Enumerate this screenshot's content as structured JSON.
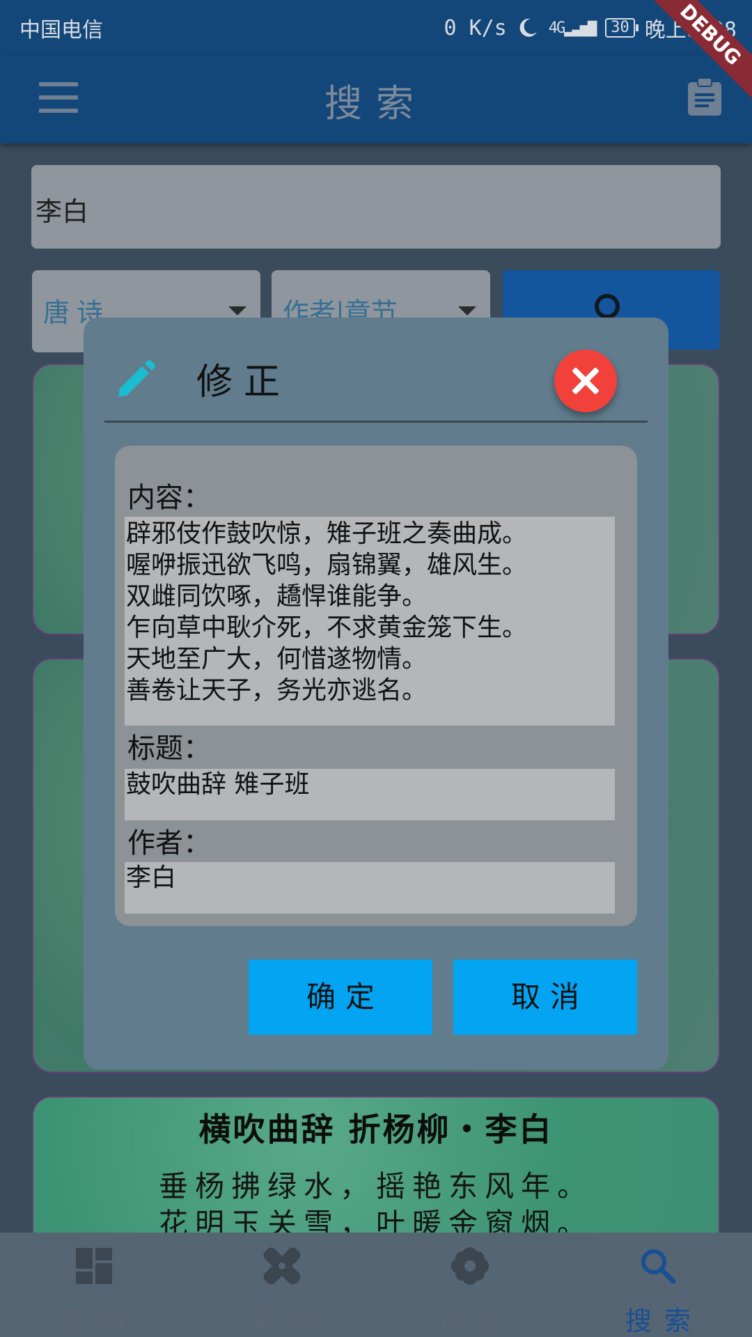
{
  "status_bar": {
    "carrier": "中国电信",
    "net_speed": "0 K/s",
    "battery": "30",
    "time": "晚上8:08",
    "icons": [
      "moon-icon",
      "4g-icon",
      "signal-icon",
      "battery-icon"
    ]
  },
  "debug_banner": "DEBUG",
  "app_bar": {
    "title": "搜索",
    "menu_icon": "menu-icon",
    "action_icon": "clipboard-icon"
  },
  "search": {
    "query": "李白",
    "category": "唐诗",
    "filter": "作者|章节",
    "button_icon": "search-icon"
  },
  "card_bottom": {
    "title": "横吹曲辞 折杨柳・李白",
    "lines": [
      "垂杨拂绿水，摇艳东风年。",
      "花明玉关雪，叶暖金窗烟。"
    ]
  },
  "dialog": {
    "title": "修正",
    "title_icon": "pencil-icon",
    "close_icon": "close-icon",
    "content_label": "内容：",
    "content_value": "辟邪伎作鼓吹惊，雉子班之奏曲成。\n喔咿振迅欲飞鸣，扇锦翼，雄风生。\n双雌同饮啄，趫悍谁能争。\n乍向草中耿介死，不求黄金笼下生。\n天地至广大，何惜遂物情。\n善卷让天子，务光亦逃名。",
    "title_label": "标题：",
    "title_value": "鼓吹曲辞 雉子班",
    "author_label": "作者：",
    "author_value": "李白",
    "confirm_label": "确定",
    "cancel_label": "取消"
  },
  "bottom_nav": {
    "items": [
      {
        "label": "唐诗",
        "icon": "dashboard-icon"
      },
      {
        "label": "宋词",
        "icon": "healing-icon"
      },
      {
        "label": "诗经",
        "icon": "flower-icon"
      },
      {
        "label": "搜索",
        "icon": "search-icon"
      }
    ],
    "active_index": 3
  },
  "colors": {
    "app_bar": "#13477a",
    "dialog": "#607c8d",
    "button": "#03a5f3",
    "close": "#f2403b",
    "active_nav": "#1a4f93"
  }
}
